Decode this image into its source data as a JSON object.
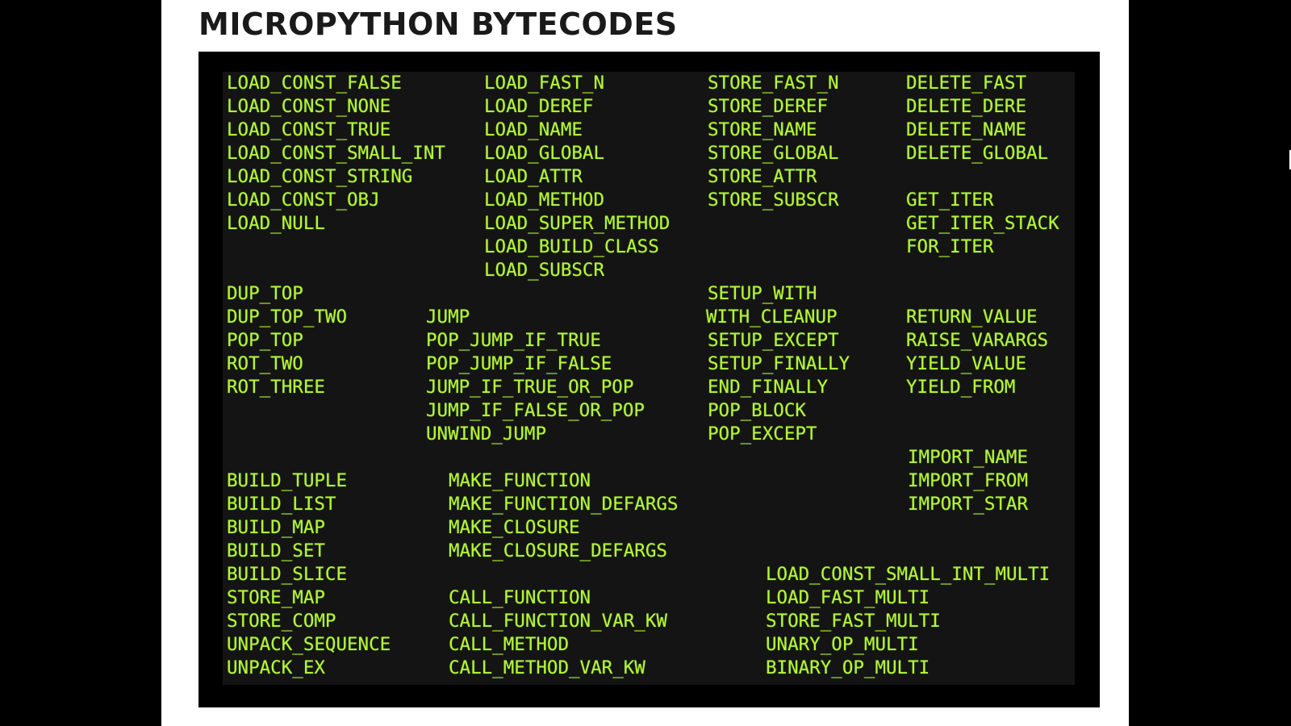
{
  "slide": {
    "title": "MICROPYTHON BYTECODES"
  },
  "colors": {
    "page_background": "#000000",
    "slide_background": "#ffffff",
    "screen_background": "#141414",
    "opcode_text": "#b4f53a"
  },
  "opcodes": {
    "load_const_false": "LOAD_CONST_FALSE",
    "load_const_none": "LOAD_CONST_NONE",
    "load_const_true": "LOAD_CONST_TRUE",
    "load_const_small_int": "LOAD_CONST_SMALL_INT",
    "load_const_string": "LOAD_CONST_STRING",
    "load_const_obj": "LOAD_CONST_OBJ",
    "load_null": "LOAD_NULL",
    "load_fast_n": "LOAD_FAST_N",
    "load_deref": "LOAD_DEREF",
    "load_name": "LOAD_NAME",
    "load_global": "LOAD_GLOBAL",
    "load_attr": "LOAD_ATTR",
    "load_method": "LOAD_METHOD",
    "load_super_method": "LOAD_SUPER_METHOD",
    "load_build_class": "LOAD_BUILD_CLASS",
    "load_subscr": "LOAD_SUBSCR",
    "store_fast_n": "STORE_FAST_N",
    "store_deref": "STORE_DEREF",
    "store_name": "STORE_NAME",
    "store_global": "STORE_GLOBAL",
    "store_attr": "STORE_ATTR",
    "store_subscr": "STORE_SUBSCR",
    "delete_fast": "DELETE_FAST",
    "delete_dere": "DELETE_DERE",
    "delete_name": "DELETE_NAME",
    "delete_global": "DELETE_GLOBAL",
    "get_iter": "GET_ITER",
    "get_iter_stack": "GET_ITER_STACK",
    "for_iter": "FOR_ITER",
    "dup_top": "DUP_TOP",
    "dup_top_two": "DUP_TOP_TWO",
    "pop_top": "POP_TOP",
    "rot_two": "ROT_TWO",
    "rot_three": "ROT_THREE",
    "jump": "JUMP",
    "pop_jump_if_true": "POP_JUMP_IF_TRUE",
    "pop_jump_if_false": "POP_JUMP_IF_FALSE",
    "jump_if_true_or_pop": "JUMP_IF_TRUE_OR_POP",
    "jump_if_false_or_pop": "JUMP_IF_FALSE_OR_POP",
    "unwind_jump": "UNWIND_JUMP",
    "setup_with": "SETUP_WITH",
    "with_cleanup": "WITH_CLEANUP",
    "setup_except": "SETUP_EXCEPT",
    "setup_finally": "SETUP_FINALLY",
    "end_finally": "END_FINALLY",
    "pop_block": "POP_BLOCK",
    "pop_except": "POP_EXCEPT",
    "return_value": "RETURN_VALUE",
    "raise_varargs": "RAISE_VARARGS",
    "yield_value": "YIELD_VALUE",
    "yield_from": "YIELD_FROM",
    "import_name": "IMPORT_NAME",
    "import_from": "IMPORT_FROM",
    "import_star": "IMPORT_STAR",
    "build_tuple": "BUILD_TUPLE",
    "build_list": "BUILD_LIST",
    "build_map": "BUILD_MAP",
    "build_set": "BUILD_SET",
    "build_slice": "BUILD_SLICE",
    "store_map": "STORE_MAP",
    "store_comp": "STORE_COMP",
    "unpack_sequence": "UNPACK_SEQUENCE",
    "unpack_ex": "UNPACK_EX",
    "make_function": "MAKE_FUNCTION",
    "make_function_defargs": "MAKE_FUNCTION_DEFARGS",
    "make_closure": "MAKE_CLOSURE",
    "make_closure_defargs": "MAKE_CLOSURE_DEFARGS",
    "call_function": "CALL_FUNCTION",
    "call_function_var_kw": "CALL_FUNCTION_VAR_KW",
    "call_method": "CALL_METHOD",
    "call_method_var_kw": "CALL_METHOD_VAR_KW",
    "load_const_small_int_multi": "LOAD_CONST_SMALL_INT_MULTI",
    "load_fast_multi": "LOAD_FAST_MULTI",
    "store_fast_multi": "STORE_FAST_MULTI",
    "unary_op_multi": "UNARY_OP_MULTI",
    "binary_op_multi": "BINARY_OP_MULTI"
  }
}
